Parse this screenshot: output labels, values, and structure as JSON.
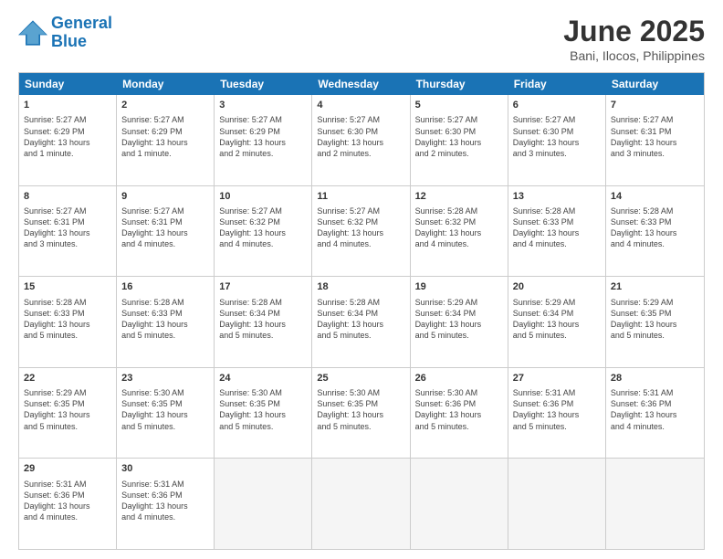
{
  "header": {
    "logo_general": "General",
    "logo_blue": "Blue",
    "month_title": "June 2025",
    "location": "Bani, Ilocos, Philippines"
  },
  "weekdays": [
    "Sunday",
    "Monday",
    "Tuesday",
    "Wednesday",
    "Thursday",
    "Friday",
    "Saturday"
  ],
  "rows": [
    [
      {
        "day": "1",
        "lines": [
          "Sunrise: 5:27 AM",
          "Sunset: 6:29 PM",
          "Daylight: 13 hours",
          "and 1 minute."
        ]
      },
      {
        "day": "2",
        "lines": [
          "Sunrise: 5:27 AM",
          "Sunset: 6:29 PM",
          "Daylight: 13 hours",
          "and 1 minute."
        ]
      },
      {
        "day": "3",
        "lines": [
          "Sunrise: 5:27 AM",
          "Sunset: 6:29 PM",
          "Daylight: 13 hours",
          "and 2 minutes."
        ]
      },
      {
        "day": "4",
        "lines": [
          "Sunrise: 5:27 AM",
          "Sunset: 6:30 PM",
          "Daylight: 13 hours",
          "and 2 minutes."
        ]
      },
      {
        "day": "5",
        "lines": [
          "Sunrise: 5:27 AM",
          "Sunset: 6:30 PM",
          "Daylight: 13 hours",
          "and 2 minutes."
        ]
      },
      {
        "day": "6",
        "lines": [
          "Sunrise: 5:27 AM",
          "Sunset: 6:30 PM",
          "Daylight: 13 hours",
          "and 3 minutes."
        ]
      },
      {
        "day": "7",
        "lines": [
          "Sunrise: 5:27 AM",
          "Sunset: 6:31 PM",
          "Daylight: 13 hours",
          "and 3 minutes."
        ]
      }
    ],
    [
      {
        "day": "8",
        "lines": [
          "Sunrise: 5:27 AM",
          "Sunset: 6:31 PM",
          "Daylight: 13 hours",
          "and 3 minutes."
        ]
      },
      {
        "day": "9",
        "lines": [
          "Sunrise: 5:27 AM",
          "Sunset: 6:31 PM",
          "Daylight: 13 hours",
          "and 4 minutes."
        ]
      },
      {
        "day": "10",
        "lines": [
          "Sunrise: 5:27 AM",
          "Sunset: 6:32 PM",
          "Daylight: 13 hours",
          "and 4 minutes."
        ]
      },
      {
        "day": "11",
        "lines": [
          "Sunrise: 5:27 AM",
          "Sunset: 6:32 PM",
          "Daylight: 13 hours",
          "and 4 minutes."
        ]
      },
      {
        "day": "12",
        "lines": [
          "Sunrise: 5:28 AM",
          "Sunset: 6:32 PM",
          "Daylight: 13 hours",
          "and 4 minutes."
        ]
      },
      {
        "day": "13",
        "lines": [
          "Sunrise: 5:28 AM",
          "Sunset: 6:33 PM",
          "Daylight: 13 hours",
          "and 4 minutes."
        ]
      },
      {
        "day": "14",
        "lines": [
          "Sunrise: 5:28 AM",
          "Sunset: 6:33 PM",
          "Daylight: 13 hours",
          "and 4 minutes."
        ]
      }
    ],
    [
      {
        "day": "15",
        "lines": [
          "Sunrise: 5:28 AM",
          "Sunset: 6:33 PM",
          "Daylight: 13 hours",
          "and 5 minutes."
        ]
      },
      {
        "day": "16",
        "lines": [
          "Sunrise: 5:28 AM",
          "Sunset: 6:33 PM",
          "Daylight: 13 hours",
          "and 5 minutes."
        ]
      },
      {
        "day": "17",
        "lines": [
          "Sunrise: 5:28 AM",
          "Sunset: 6:34 PM",
          "Daylight: 13 hours",
          "and 5 minutes."
        ]
      },
      {
        "day": "18",
        "lines": [
          "Sunrise: 5:28 AM",
          "Sunset: 6:34 PM",
          "Daylight: 13 hours",
          "and 5 minutes."
        ]
      },
      {
        "day": "19",
        "lines": [
          "Sunrise: 5:29 AM",
          "Sunset: 6:34 PM",
          "Daylight: 13 hours",
          "and 5 minutes."
        ]
      },
      {
        "day": "20",
        "lines": [
          "Sunrise: 5:29 AM",
          "Sunset: 6:34 PM",
          "Daylight: 13 hours",
          "and 5 minutes."
        ]
      },
      {
        "day": "21",
        "lines": [
          "Sunrise: 5:29 AM",
          "Sunset: 6:35 PM",
          "Daylight: 13 hours",
          "and 5 minutes."
        ]
      }
    ],
    [
      {
        "day": "22",
        "lines": [
          "Sunrise: 5:29 AM",
          "Sunset: 6:35 PM",
          "Daylight: 13 hours",
          "and 5 minutes."
        ]
      },
      {
        "day": "23",
        "lines": [
          "Sunrise: 5:30 AM",
          "Sunset: 6:35 PM",
          "Daylight: 13 hours",
          "and 5 minutes."
        ]
      },
      {
        "day": "24",
        "lines": [
          "Sunrise: 5:30 AM",
          "Sunset: 6:35 PM",
          "Daylight: 13 hours",
          "and 5 minutes."
        ]
      },
      {
        "day": "25",
        "lines": [
          "Sunrise: 5:30 AM",
          "Sunset: 6:35 PM",
          "Daylight: 13 hours",
          "and 5 minutes."
        ]
      },
      {
        "day": "26",
        "lines": [
          "Sunrise: 5:30 AM",
          "Sunset: 6:36 PM",
          "Daylight: 13 hours",
          "and 5 minutes."
        ]
      },
      {
        "day": "27",
        "lines": [
          "Sunrise: 5:31 AM",
          "Sunset: 6:36 PM",
          "Daylight: 13 hours",
          "and 5 minutes."
        ]
      },
      {
        "day": "28",
        "lines": [
          "Sunrise: 5:31 AM",
          "Sunset: 6:36 PM",
          "Daylight: 13 hours",
          "and 4 minutes."
        ]
      }
    ],
    [
      {
        "day": "29",
        "lines": [
          "Sunrise: 5:31 AM",
          "Sunset: 6:36 PM",
          "Daylight: 13 hours",
          "and 4 minutes."
        ]
      },
      {
        "day": "30",
        "lines": [
          "Sunrise: 5:31 AM",
          "Sunset: 6:36 PM",
          "Daylight: 13 hours",
          "and 4 minutes."
        ]
      },
      {
        "day": "",
        "lines": []
      },
      {
        "day": "",
        "lines": []
      },
      {
        "day": "",
        "lines": []
      },
      {
        "day": "",
        "lines": []
      },
      {
        "day": "",
        "lines": []
      }
    ]
  ]
}
